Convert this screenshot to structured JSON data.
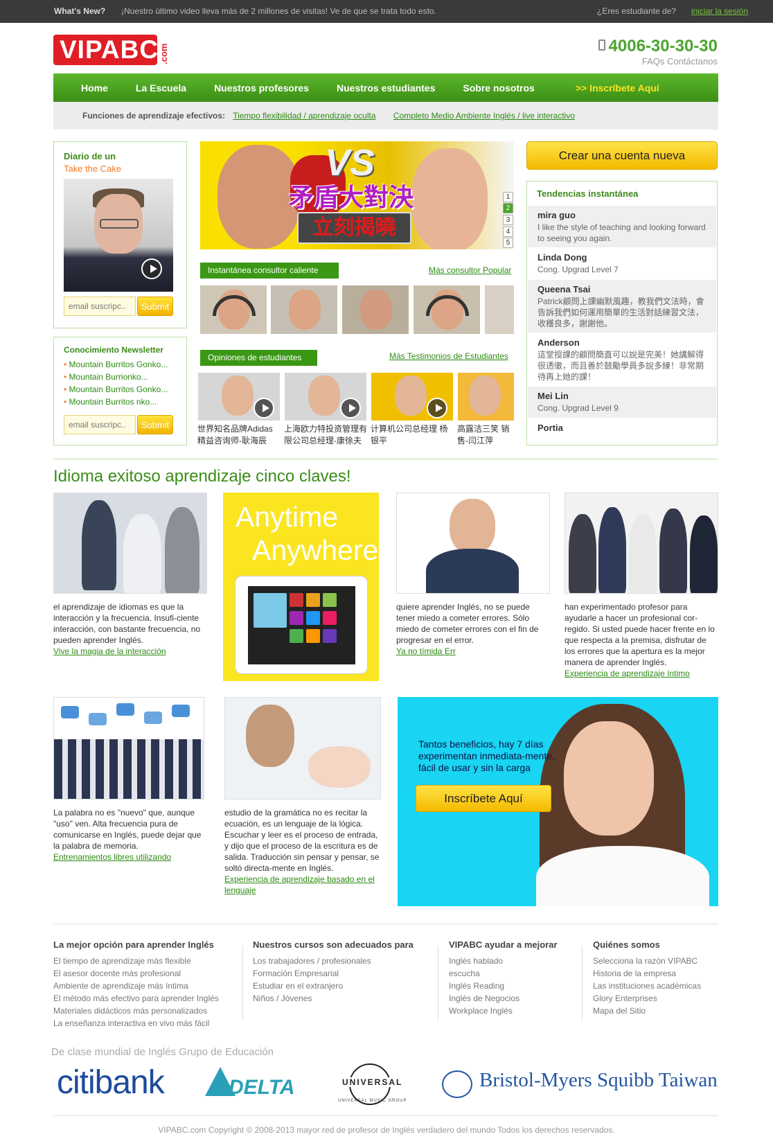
{
  "topbar": {
    "whats_new": "What's New?",
    "message": "¡Nuestro último video lleva más de 2 millones de visitas! Ve de que se trata todo esto.",
    "student_q": "¿Eres estudiante de?",
    "login": "iniciar la sesión"
  },
  "header": {
    "logo": "VIPABC",
    "logo_com": ".com",
    "phone": "4006-30-30-30",
    "faqs": "FAQs Contáctanos"
  },
  "nav": {
    "items": [
      "Home",
      "La Escuela",
      "Nuestros profesores",
      "Nuestros estudiantes",
      "Sobre nosotros"
    ],
    "signup": ">> Inscríbete Aquí"
  },
  "features": {
    "label": "Funciones de aprendizaje efectivos:",
    "link1": "Tiempo flexibilidad / aprendizaje oculta",
    "link2": "Completo Medio Ambiente Inglés / live interactivo"
  },
  "diario": {
    "title": "Diario de un",
    "subtitle": "Take the Cake",
    "email_placeholder": "email suscripc..",
    "submit": "Submit"
  },
  "newsletter": {
    "title": "Conocimiento Newsletter",
    "items": [
      "Mountain Burritos Gonko...",
      "Mountain Burrionko...",
      "Mountain Burritos Gonko...",
      "Mountain Burritos nko..."
    ],
    "email_placeholder": "email suscripc..",
    "submit": "Submit"
  },
  "banner": {
    "vs": "VS",
    "headline": "矛盾大對決",
    "button": "立刻揭曉",
    "pages": [
      "1",
      "2",
      "3",
      "4",
      "5"
    ],
    "active_page": "2"
  },
  "consultants": {
    "tag": "Instantánea consultor caliente",
    "more": "Más consultor Popular"
  },
  "opinions": {
    "tag": "Opiniones de estudiantes",
    "more": "Más Testimonios de Estudiantes",
    "captions": [
      "世界知名品牌Adidas精益咨询师-耿海辰",
      "上海欧力特投资管理有限公司总经理-康徐夫",
      "计算机公司总经理 杨银平",
      "高露洁三笑 销售-闫江萍"
    ]
  },
  "sidebar": {
    "create_account": "Crear una cuenta nueva",
    "trends_title": "Tendencias instantánea",
    "trends": [
      {
        "name": "mira guo",
        "comment": "I like the style of teaching and looking forward to seeing you again."
      },
      {
        "name": "Linda Dong",
        "comment": "Cong. Upgrad Level 7"
      },
      {
        "name": "Queena Tsai",
        "comment": "Patrick顧問上課幽默風趣，教我們文法時，會告訴我們如何運用簡單的生活對話練習文法，收穫良多，謝謝他。"
      },
      {
        "name": "Anderson",
        "comment": "這堂授課的顧問簡直可以說是完美！她講解得很透徹，而且善於鼓勵學員多說多練！非常期待再上她的課！"
      },
      {
        "name": "Mei Lin",
        "comment": "Cong. Upgrad Level 9"
      },
      {
        "name": "Portia",
        "comment": ""
      }
    ]
  },
  "keys": {
    "title": "Idioma exitoso aprendizaje cinco claves!",
    "anytime": "Anytime",
    "anywhere": "Anywhere",
    "items": [
      {
        "text": "el aprendizaje de idiomas es que la interacción y la frecuencia. Insufi-ciente interacción, con bastante frecuencia, no pueden aprender Inglés.",
        "link": "Vive la magia de la interacción"
      },
      {
        "text": "quiere aprender Inglés, no se puede tener miedo a cometer errores. Sólo miedo de cometer errores con el fin de progresar en el error.",
        "link": "Ya no tímida Err"
      },
      {
        "text": "han experimentado profesor para ayudarle a hacer un profesional cor-regido. Si usted puede hacer frente en lo que respecta a la premisa, disfrutar de los errores que la apertura es la mejor manera de aprender Inglés.",
        "link": "Experiencia de aprendizaje íntimo"
      },
      {
        "text": "La palabra no es \"nuevo\" que, aunque \"uso\" ven. Alta frecuencia pura de comunicarse en Inglés, puede dejar que la palabra de memoria.",
        "link": "Entrenamientos libres utilizando"
      },
      {
        "text": "estudio de la gramática no es recitar la ecuación, es un lenguaje de la lógica. Escuchar y leer es el proceso de entrada, y dijo que el proceso de la escritura es de salida. Traducción sin pensar y pensar, se soltó directa-mente en Inglés.",
        "link": "Experiencia de aprendizaje basado en el lenguaje"
      }
    ],
    "promo_text": "Tantos beneficios, hay 7 días experimentan inmediata-mente, fácil de usar y sin la carga",
    "promo_button": "Inscríbete Aquí"
  },
  "footer": {
    "cols": [
      {
        "title": "La mejor opción para aprender Inglés",
        "items": [
          "El tiempo de aprendizaje más flexible",
          "El asesor docente más profesional",
          "Ambiente de aprendizaje más íntima",
          "El método más efectivo para aprender Inglés",
          "Materiales didácticos más personalizados",
          "La enseñanza interactiva en vivo más fácil"
        ]
      },
      {
        "title": "Nuestros cursos son adecuados para",
        "items": [
          "Los trabajadores / profesionales",
          "Formación Empresarial",
          "Estudiar en el extranjero",
          "Niños / Jóvenes"
        ]
      },
      {
        "title": "VIPABC ayudar a mejorar",
        "items": [
          "Inglés hablado",
          "escucha",
          "Inglés Reading",
          "Inglés de Negocios",
          "Workplace Inglés"
        ]
      },
      {
        "title": "Quiénes somos",
        "items": [
          "Selecciona la razón VIPABC",
          "Historia de la empresa",
          "Las instituciones académicas",
          "Glory Enterprises",
          "Mapa del Sitio"
        ]
      }
    ],
    "partners_title": "De clase mundial de Inglés Grupo de Educación",
    "partners": [
      "citibank",
      "DELTA",
      "UNIVERSAL",
      "UNIVERSAL MUSIC GROUP",
      "Bristol-Myers Squibb Taiwan"
    ],
    "copyright": "VIPABC.com Copyright © 2008-2013 mayor red de profesor de Inglés verdadero del mundo Todos los derechos reservados."
  },
  "colors": {
    "green": "#3a9815",
    "red": "#e01e26",
    "yellow": "#f4b900",
    "cyan": "#19d4f2"
  }
}
